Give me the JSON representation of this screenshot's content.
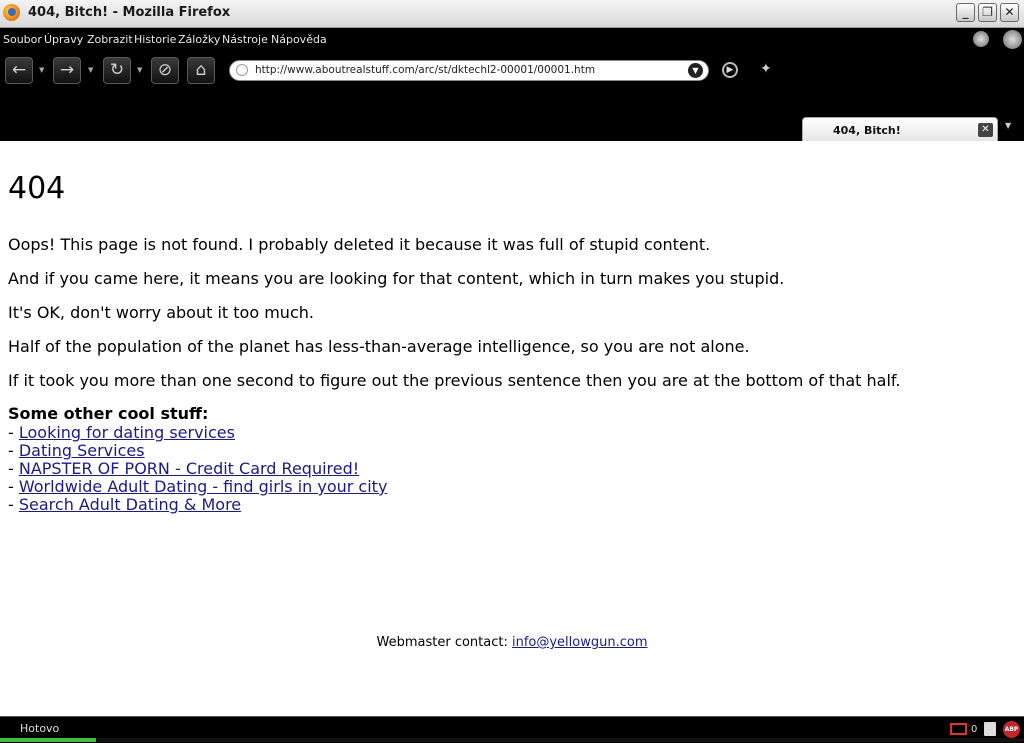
{
  "window": {
    "title": "404, Bitch! - Mozilla Firefox",
    "controls": {
      "minimize": "_",
      "maximize": "❐",
      "close": "✕"
    }
  },
  "menubar": {
    "items": [
      "Soubor",
      "Úpravy",
      "Zobrazit",
      "Historie",
      "Záložky",
      "Nástroje",
      "Nápověda"
    ]
  },
  "navbar": {
    "back_icon": "←",
    "forward_icon": "→",
    "reload_icon": "↻",
    "stop_icon": "⊘",
    "home_icon": "⌂",
    "url": "http://www.aboutrealstuff.com/arc/st/dktechl2-00001/00001.htm",
    "url_dropdown_icon": "▼",
    "go_icon": "▶",
    "bookmark_icon": "✦"
  },
  "tabs": [
    {
      "label": "404, Bitch!",
      "close_icon": "✕"
    }
  ],
  "tab_list_icon": "▼",
  "page": {
    "heading": "404",
    "paragraphs": [
      "Oops! This page is not found. I probably deleted it because it was full of stupid content.",
      "And if you came here, it means you are looking for that content, which in turn makes you stupid.",
      "It's OK, don't worry about it too much.",
      "Half of the population of the planet has less-than-average intelligence, so you are not alone.",
      "If it took you more than one second to figure out the previous sentence then you are at the bottom of that half."
    ],
    "cool_stuff_heading": "Some other cool stuff:",
    "link_prefix": "- ",
    "links": [
      "Looking for dating services ",
      "Dating Services ",
      "NAPSTER OF PORN - Credit Card Required! ",
      "Worldwide Adult Dating - find girls in your city ",
      "Search Adult Dating & More "
    ],
    "webmaster_label": "Webmaster contact: ",
    "webmaster_email": "info@yellowgun.com"
  },
  "statusbar": {
    "status": "Hotovo",
    "gmail_count": "0",
    "abp_label": "ABP"
  }
}
